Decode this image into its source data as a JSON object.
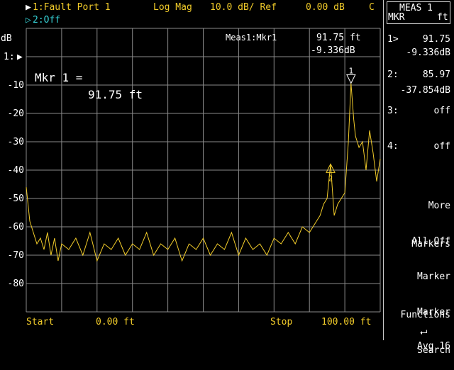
{
  "header": {
    "channel1_marker": "▶",
    "channel1": "1:Fault Port 1",
    "format": "Log Mag",
    "scale": "10.0 dB/ Ref",
    "ref": "0.00 dB",
    "cal": "C",
    "channel2_marker": "▷",
    "channel2": "2:Off"
  },
  "axis": {
    "unit": "dB",
    "ref_label": "1:",
    "ref_arrow": "▶",
    "y_ticks": [
      "-10",
      "-20",
      "-30",
      "-40",
      "-50",
      "-60",
      "-70",
      "-80"
    ],
    "start_label": "Start",
    "start_value": "0.00 ft",
    "stop_label": "Stop",
    "stop_value": "100.00 ft"
  },
  "readout": {
    "name": "Meas1:Mkr1",
    "x": "91.75 ft",
    "y": "-9.336dB"
  },
  "big_marker": {
    "line1": "Mkr 1 =",
    "line2": "91.75 ft"
  },
  "markers": [
    {
      "label": "1",
      "x_ft": 91.75,
      "y_db": -9.336
    },
    {
      "label": "2",
      "x_ft": 85.97,
      "y_db": -37.854
    }
  ],
  "menu": {
    "title1": "MEAS 1",
    "title2_left": "MKR",
    "title2_right": "ft",
    "mkr1_label": "1>",
    "mkr1_x": "91.75",
    "mkr1_y": "-9.336dB",
    "mkr2_label": "2:",
    "mkr2_x": "85.97",
    "mkr2_y": "-37.854dB",
    "mkr3_label": "3:",
    "mkr3_val": "off",
    "mkr4_label": "4:",
    "mkr4_val": "off",
    "more_markers_1": "More",
    "more_markers_2": "Markers",
    "all_off": "All Off",
    "marker_functions_1": "Marker",
    "marker_functions_2": "Functions",
    "marker_search_1": "Marker",
    "marker_search_2": "Search",
    "avg": "Avg 16",
    "return_symbol": "⮠"
  },
  "chart_data": {
    "type": "line",
    "xlabel": "",
    "ylabel": "dB",
    "xlim": [
      0,
      100
    ],
    "ylim": [
      -90,
      10
    ],
    "grid": true,
    "series": [
      {
        "x": [
          0,
          1,
          2,
          3,
          4,
          5,
          6,
          7,
          8,
          9,
          10,
          12,
          14,
          16,
          18,
          20,
          22,
          24,
          26,
          28,
          30,
          32,
          34,
          36,
          38,
          40,
          42,
          44,
          46,
          48,
          50,
          52,
          54,
          56,
          58,
          60,
          62,
          64,
          66,
          68,
          70,
          72,
          74,
          76,
          78,
          80,
          82,
          83,
          84,
          85,
          85.97,
          87,
          88,
          89,
          90,
          91,
          91.75,
          92.5,
          93,
          94,
          95,
          96,
          97,
          98,
          99,
          100
        ],
        "y": [
          -46,
          -58,
          -62,
          -66,
          -64,
          -68,
          -62,
          -70,
          -64,
          -72,
          -66,
          -68,
          -64,
          -70,
          -62,
          -72,
          -66,
          -68,
          -64,
          -70,
          -66,
          -68,
          -62,
          -70,
          -66,
          -68,
          -64,
          -72,
          -66,
          -68,
          -64,
          -70,
          -66,
          -68,
          -62,
          -70,
          -64,
          -68,
          -66,
          -70,
          -64,
          -66,
          -62,
          -66,
          -60,
          -62,
          -58,
          -56,
          -52,
          -50,
          -37.854,
          -56,
          -52,
          -50,
          -48,
          -30,
          -9.336,
          -22,
          -28,
          -32,
          -30,
          -40,
          -26,
          -34,
          -44,
          -36
        ]
      }
    ]
  }
}
